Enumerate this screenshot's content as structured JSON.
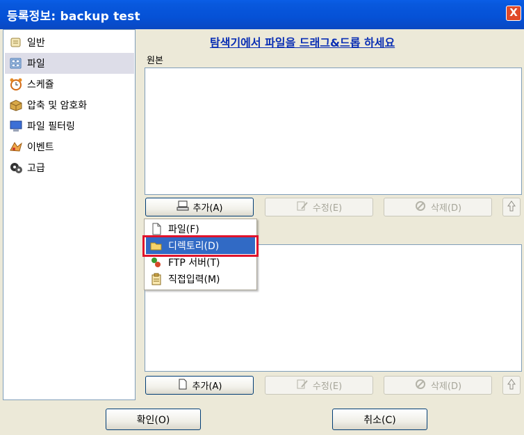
{
  "window": {
    "title": "등록정보: backup test",
    "close_label": "X"
  },
  "sidebar": {
    "items": [
      {
        "label": "일반",
        "icon": "general-icon",
        "selected": false
      },
      {
        "label": "파일",
        "icon": "file-cabinet-icon",
        "selected": true
      },
      {
        "label": "스케쥴",
        "icon": "alarm-clock-icon",
        "selected": false
      },
      {
        "label": "압축 및 암호화",
        "icon": "package-icon",
        "selected": false
      },
      {
        "label": "파일 필터링",
        "icon": "monitor-icon",
        "selected": false
      },
      {
        "label": "이벤트",
        "icon": "event-icon",
        "selected": false
      },
      {
        "label": "고급",
        "icon": "advanced-icon",
        "selected": false
      }
    ]
  },
  "main": {
    "drag_hint": "탐색기에서 파일을 드래그&드롭 하세요",
    "source_label": "원본",
    "source_buttons": {
      "add": "추가(A)",
      "edit": "수정(E)",
      "delete": "삭제(D)"
    },
    "exclude_buttons": {
      "add": "추가(A)",
      "edit": "수정(E)",
      "delete": "삭제(D)"
    }
  },
  "add_menu": {
    "items": [
      {
        "label": "파일(F)",
        "icon": "file-icon"
      },
      {
        "label": "디렉토리(D)",
        "icon": "folder-icon",
        "highlighted": true
      },
      {
        "label": "FTP 서버(T)",
        "icon": "ftp-server-icon"
      },
      {
        "label": "직접입력(M)",
        "icon": "clipboard-icon"
      }
    ]
  },
  "footer": {
    "ok": "확인(O)",
    "cancel": "취소(C)"
  },
  "colors": {
    "titlebar": "#0551d6",
    "highlight": "#316ac5",
    "annotation_box": "#e0132b",
    "link": "#0a2fb4"
  }
}
